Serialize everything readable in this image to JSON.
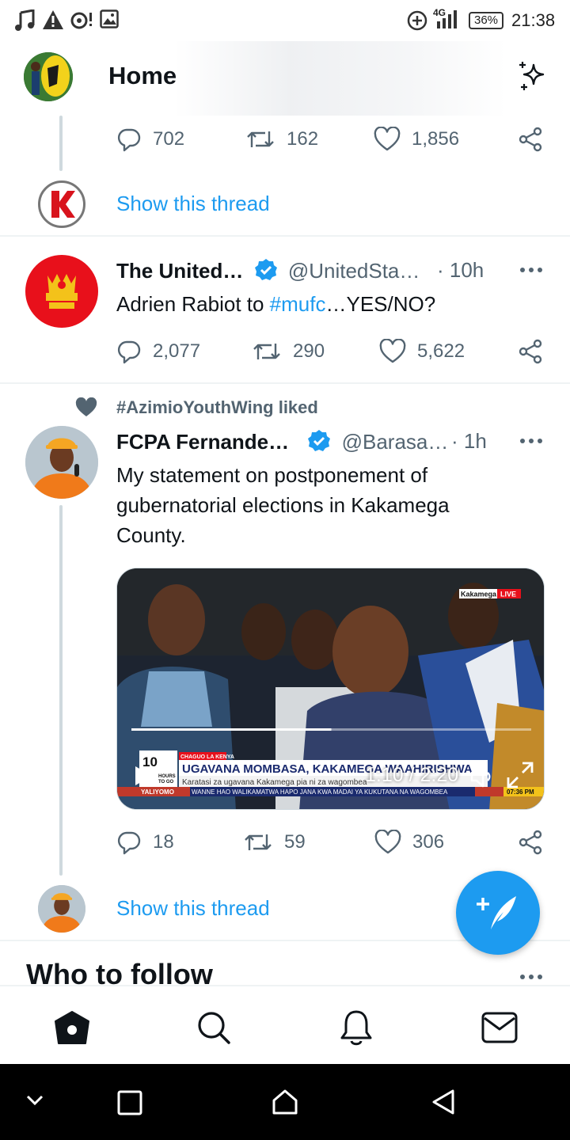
{
  "status_bar": {
    "time": "21:38",
    "battery": "36%",
    "network": "4G",
    "icons": [
      "music-icon",
      "warning-icon",
      "mic-icon",
      "image-icon",
      "data-saver-icon",
      "signal-icon",
      "battery-icon"
    ]
  },
  "header": {
    "title": "Home",
    "sparkle_icon": "sparkle-icon"
  },
  "tweet0": {
    "replies": "702",
    "retweets": "162",
    "likes": "1,856",
    "show_thread": "Show this thread"
  },
  "tweet1": {
    "name": "The United…",
    "handle": "@UnitedSta…",
    "time": "· 10h",
    "text_pre": "Adrien Rabiot to ",
    "hashtag": "#mufc",
    "text_post": "…YES/NO?",
    "replies": "2,077",
    "retweets": "290",
    "likes": "5,622"
  },
  "tweet2": {
    "social_context": "#AzimioYouthWing liked",
    "name": "FCPA Fernande…",
    "handle": "@Barasa…",
    "time": "· 1h",
    "text": "My statement on postponement of gubernatorial elections in Kakamega County.",
    "video": {
      "time": "1:10 / 2:20",
      "progress": 0.5,
      "banner_top": "CHAGUO LA KENYA",
      "headline": "UGAVANA MOMBASA, KAKAMEGA WAAHIRISHWA",
      "subline": "Karatasi za ugavana Kakamega pia ni za wagombea",
      "ticker": "WANNE HAO WALIKAMATWA HAPO JANA KWA MADAI YA KUKUTANA NA WAGOMBEA",
      "ticker_left": "YALIYOMO",
      "badge_num": "10",
      "badge_text1": "HOURS",
      "badge_text2": "TO GO",
      "live_place": "Kakamega",
      "live": "LIVE",
      "clock": "07:36 PM"
    },
    "replies": "18",
    "retweets": "59",
    "likes": "306",
    "show_thread": "Show this thread"
  },
  "who_to_follow": {
    "title": "Who to follow"
  },
  "colors": {
    "accent": "#1d9bf0",
    "text": "#0f1419",
    "muted": "#536471",
    "united_red": "#e8101b"
  }
}
